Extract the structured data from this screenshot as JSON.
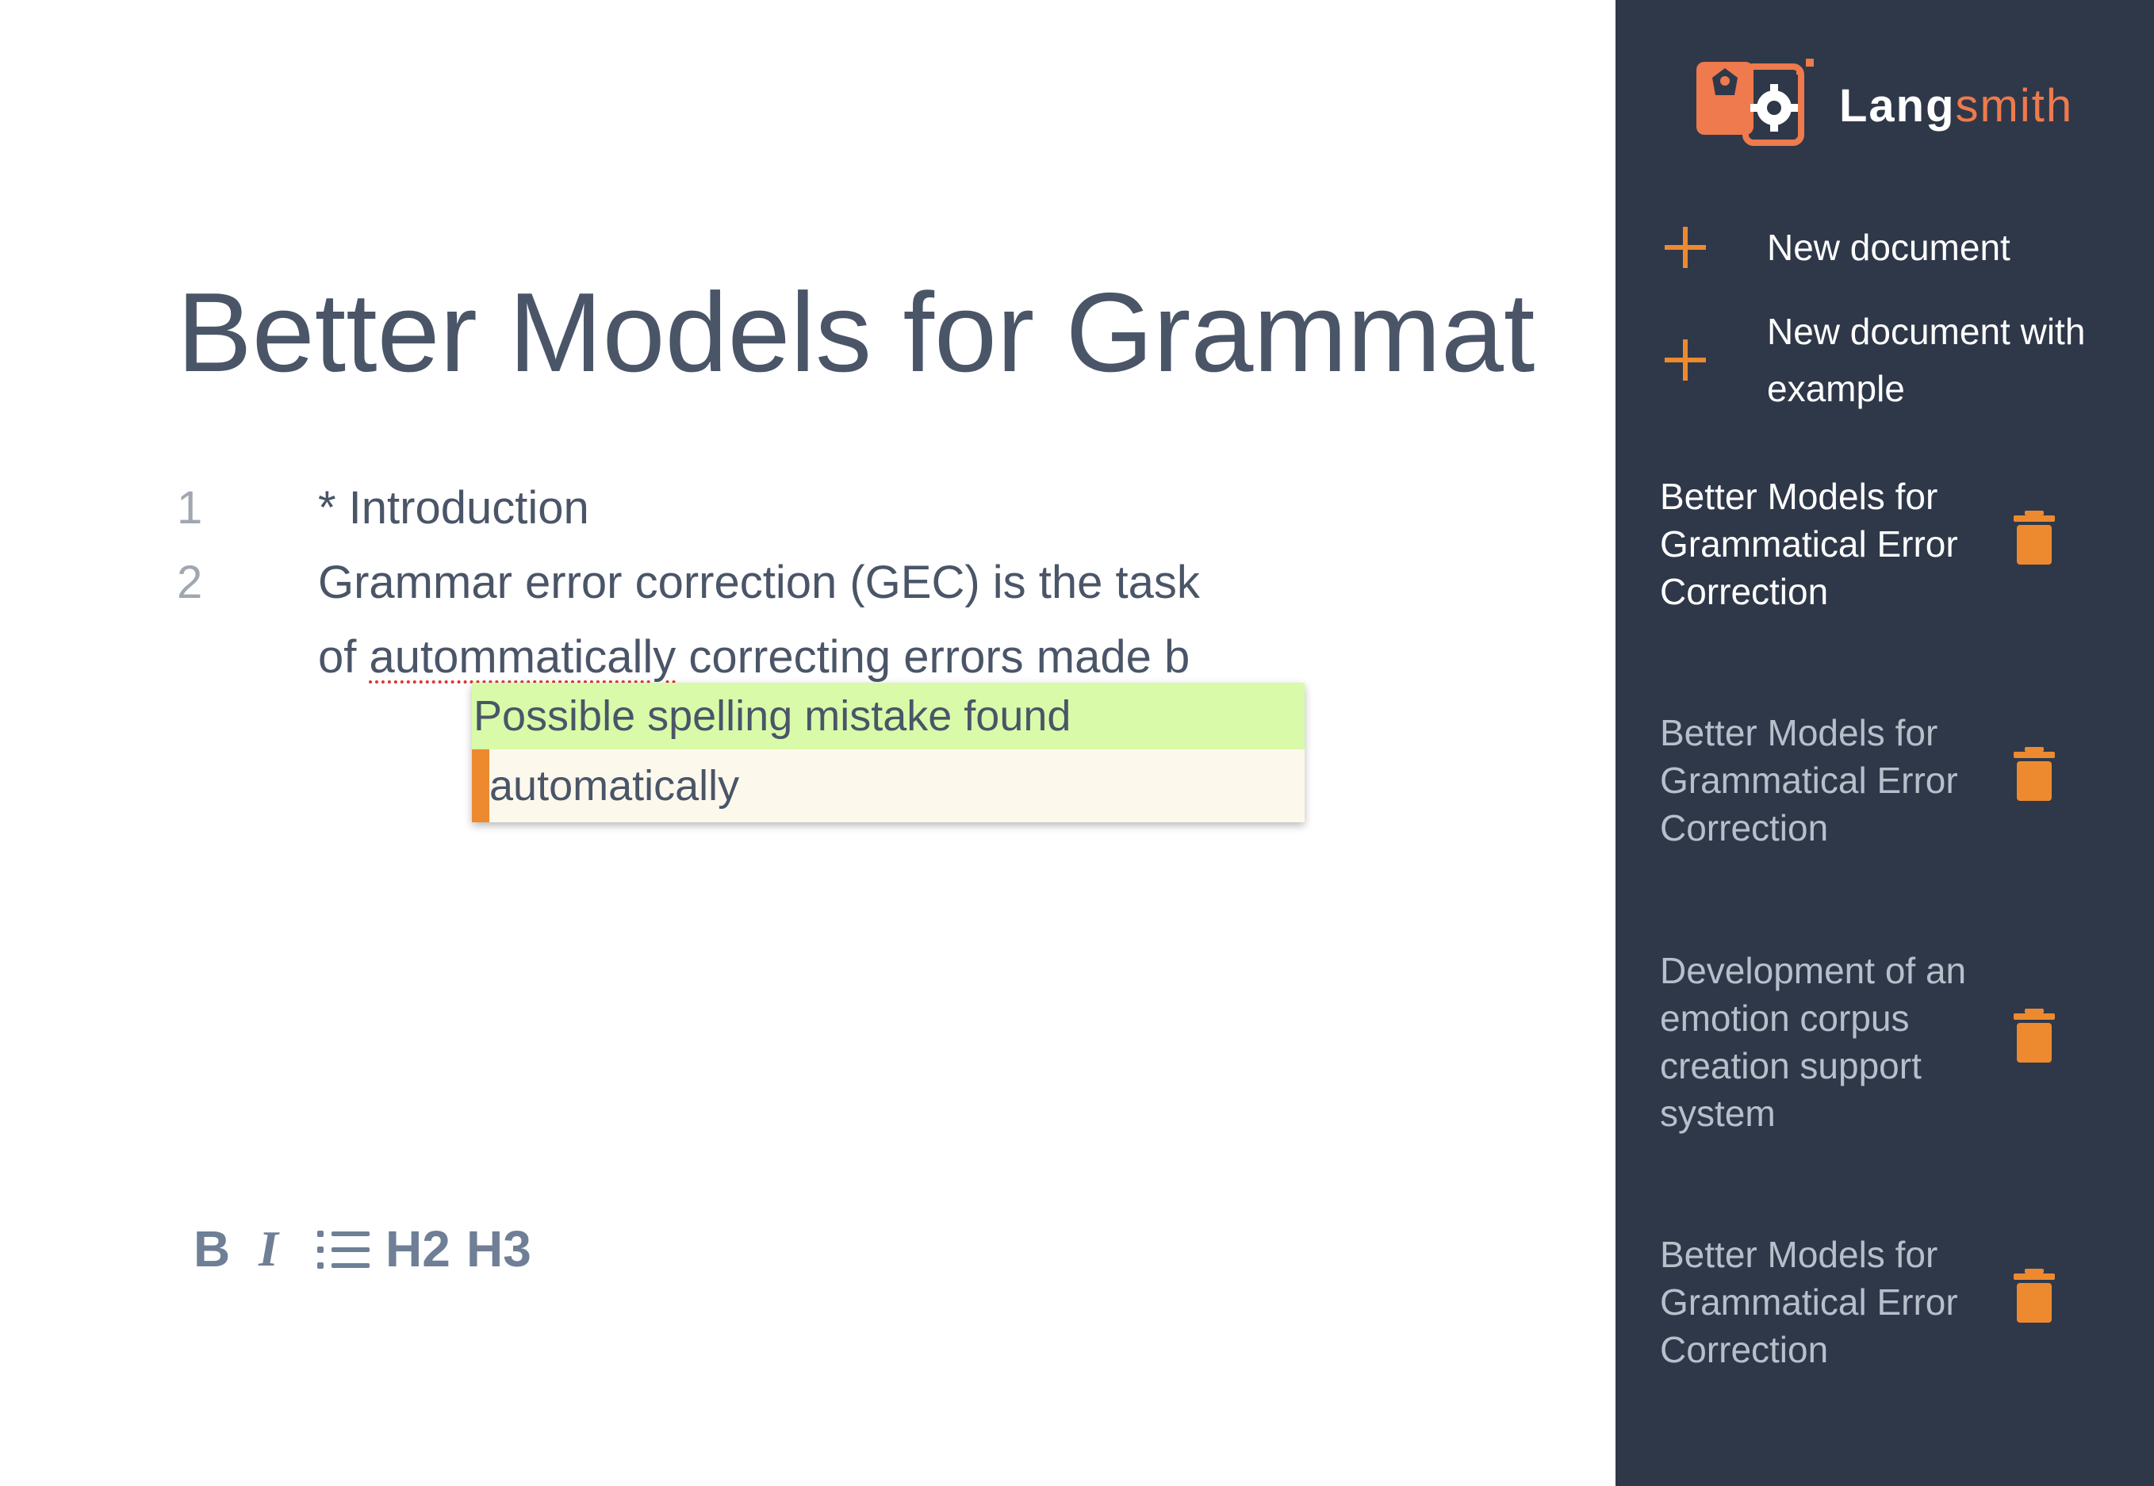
{
  "editor": {
    "title": "Better Models for Grammat",
    "lines": [
      {
        "number": "1",
        "text": "* Introduction"
      },
      {
        "number": "2",
        "before": "Grammar error correction (GEC) is the task of ",
        "misspelled": "autommatically",
        "after": " correcting errors made b"
      }
    ],
    "popup": {
      "message": "Possible spelling mistake found",
      "suggestion": "automatically"
    },
    "toolbar": {
      "bold": "B",
      "italic": "I",
      "h2": "H2",
      "h3": "H3"
    }
  },
  "sidebar": {
    "logo": {
      "part1": "Lang",
      "part2": "smith"
    },
    "new_document": "New document",
    "new_document_example": "New document with example",
    "documents": [
      {
        "title": "Better Models for Grammatical Error Correction"
      },
      {
        "title": "Better Models for Grammatical Error Correction"
      },
      {
        "title": "Development of an emotion corpus creation support system"
      },
      {
        "title": "Better Models for Grammatical Error Correction"
      }
    ]
  },
  "colors": {
    "sidebar_bg": "#2f3849",
    "accent_orange": "#ed8a2f",
    "logo_orange": "#ee7a4d",
    "popup_header_bg": "#d9fba9",
    "popup_body_bg": "#fdf8ec",
    "text_dark": "#4a5568",
    "toolbar_icon": "#6e7f96"
  },
  "icons": [
    "logo-icon",
    "plus-icon",
    "trash-icon",
    "list-icon"
  ]
}
